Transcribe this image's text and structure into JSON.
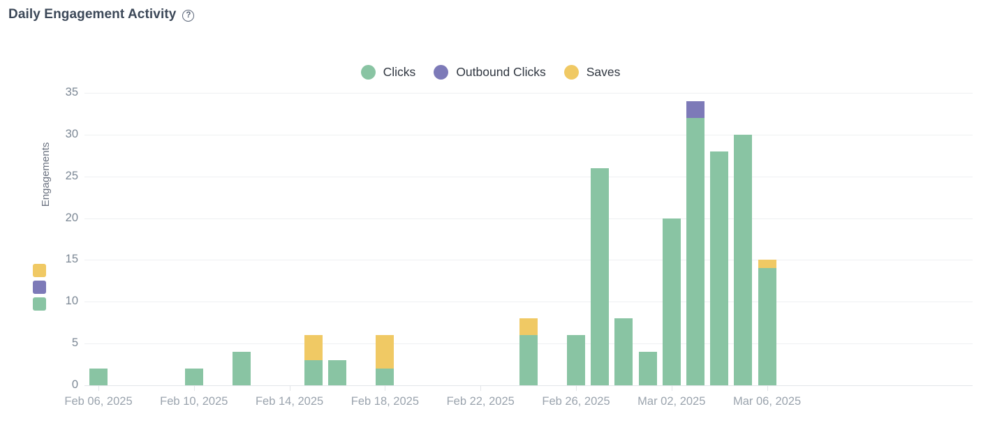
{
  "header": {
    "title": "Daily Engagement Activity",
    "help_icon": "question-mark-circle-icon",
    "help_glyph": "?"
  },
  "legend": {
    "items": [
      {
        "label": "Clicks",
        "color": "#89c4a3"
      },
      {
        "label": "Outbound Clicks",
        "color": "#7d7ab8"
      },
      {
        "label": "Saves",
        "color": "#f0c964"
      }
    ]
  },
  "side_swatches": [
    {
      "name": "saves-swatch",
      "color": "#f0c964"
    },
    {
      "name": "outbound-clicks-swatch",
      "color": "#7d7ab8"
    },
    {
      "name": "clicks-swatch",
      "color": "#89c4a3"
    }
  ],
  "chart_data": {
    "type": "bar",
    "stacked": true,
    "title": "Daily Engagement Activity",
    "xlabel": "",
    "ylabel": "Engagements",
    "ylim": [
      0,
      35
    ],
    "yticks": [
      0,
      5,
      10,
      15,
      20,
      25,
      30,
      35
    ],
    "grid": true,
    "legend_position": "top-center",
    "x_tick_labels": [
      "Feb 06, 2025",
      "Feb 10, 2025",
      "Feb 14, 2025",
      "Feb 18, 2025",
      "Feb 22, 2025",
      "Feb 26, 2025",
      "Mar 02, 2025",
      "Mar 06, 2025"
    ],
    "categories": [
      "Feb 05, 2025",
      "Feb 06, 2025",
      "Feb 07, 2025",
      "Feb 08, 2025",
      "Feb 09, 2025",
      "Feb 10, 2025",
      "Feb 11, 2025",
      "Feb 12, 2025",
      "Feb 13, 2025",
      "Feb 14, 2025",
      "Feb 15, 2025",
      "Feb 16, 2025",
      "Feb 17, 2025",
      "Feb 18, 2025",
      "Feb 19, 2025",
      "Feb 20, 2025",
      "Feb 21, 2025",
      "Feb 22, 2025",
      "Feb 23, 2025",
      "Feb 24, 2025",
      "Feb 25, 2025",
      "Feb 26, 2025",
      "Feb 27, 2025",
      "Feb 28, 2025",
      "Mar 01, 2025",
      "Mar 02, 2025",
      "Mar 03, 2025",
      "Mar 04, 2025",
      "Mar 05, 2025",
      "Mar 06, 2025"
    ],
    "series": [
      {
        "name": "Clicks",
        "color": "#89c4a3",
        "values": [
          0,
          2,
          0,
          0,
          0,
          2,
          0,
          4,
          0,
          0,
          3,
          3,
          0,
          2,
          0,
          0,
          0,
          0,
          0,
          6,
          0,
          6,
          26,
          8,
          4,
          20,
          32,
          28,
          30,
          14
        ]
      },
      {
        "name": "Outbound Clicks",
        "color": "#7d7ab8",
        "values": [
          0,
          0,
          0,
          0,
          0,
          0,
          0,
          0,
          0,
          0,
          0,
          0,
          0,
          0,
          0,
          0,
          0,
          0,
          0,
          0,
          0,
          0,
          0,
          0,
          0,
          0,
          2,
          0,
          0,
          0
        ]
      },
      {
        "name": "Saves",
        "color": "#f0c964",
        "values": [
          0,
          0,
          0,
          0,
          0,
          0,
          0,
          0,
          0,
          0,
          3,
          0,
          0,
          4,
          0,
          0,
          0,
          0,
          0,
          2,
          0,
          0,
          0,
          0,
          0,
          0,
          0,
          0,
          0,
          1
        ]
      }
    ],
    "totals": [
      0,
      2,
      0,
      0,
      0,
      2,
      0,
      4,
      0,
      0,
      6,
      3,
      0,
      6,
      0,
      0,
      0,
      0,
      0,
      8,
      0,
      6,
      26,
      8,
      4,
      20,
      34,
      28,
      30,
      15
    ]
  }
}
